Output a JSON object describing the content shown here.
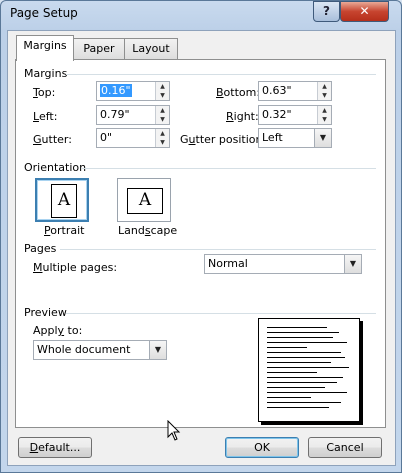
{
  "window": {
    "title": "Page Setup",
    "help_label": "?",
    "close_label": "✕"
  },
  "tabs": [
    {
      "label": "Margins",
      "active": true
    },
    {
      "label": "Paper",
      "active": false
    },
    {
      "label": "Layout",
      "active": false
    }
  ],
  "margins": {
    "group_label": "Margins",
    "top": {
      "label": "Top:",
      "value": "0.16\""
    },
    "bottom": {
      "label": "Bottom:",
      "value": "0.63\""
    },
    "left": {
      "label": "Left:",
      "value": "0.79\""
    },
    "right": {
      "label": "Right:",
      "value": "0.32\""
    },
    "gutter": {
      "label": "Gutter:",
      "value": "0\""
    },
    "gutter_position": {
      "label": "Gutter position:",
      "value": "Left"
    }
  },
  "orientation": {
    "group_label": "Orientation",
    "portrait_label": "Portrait",
    "landscape_label": "Landscape",
    "icon_letter": "A",
    "selected": "portrait"
  },
  "pages": {
    "group_label": "Pages",
    "multiple_pages_label": "Multiple pages:",
    "multiple_pages_value": "Normal"
  },
  "preview": {
    "group_label": "Preview",
    "apply_to_label": "Apply to:",
    "apply_to_value": "Whole document"
  },
  "buttons": {
    "default": "Default...",
    "ok": "OK",
    "cancel": "Cancel"
  },
  "icons": {
    "spin_up": "▲",
    "spin_down": "▼",
    "dropdown": "▼"
  },
  "colors": {
    "selection": "#3399ff",
    "focus_border": "#3c7fb1",
    "close_red": "#c7442f"
  }
}
